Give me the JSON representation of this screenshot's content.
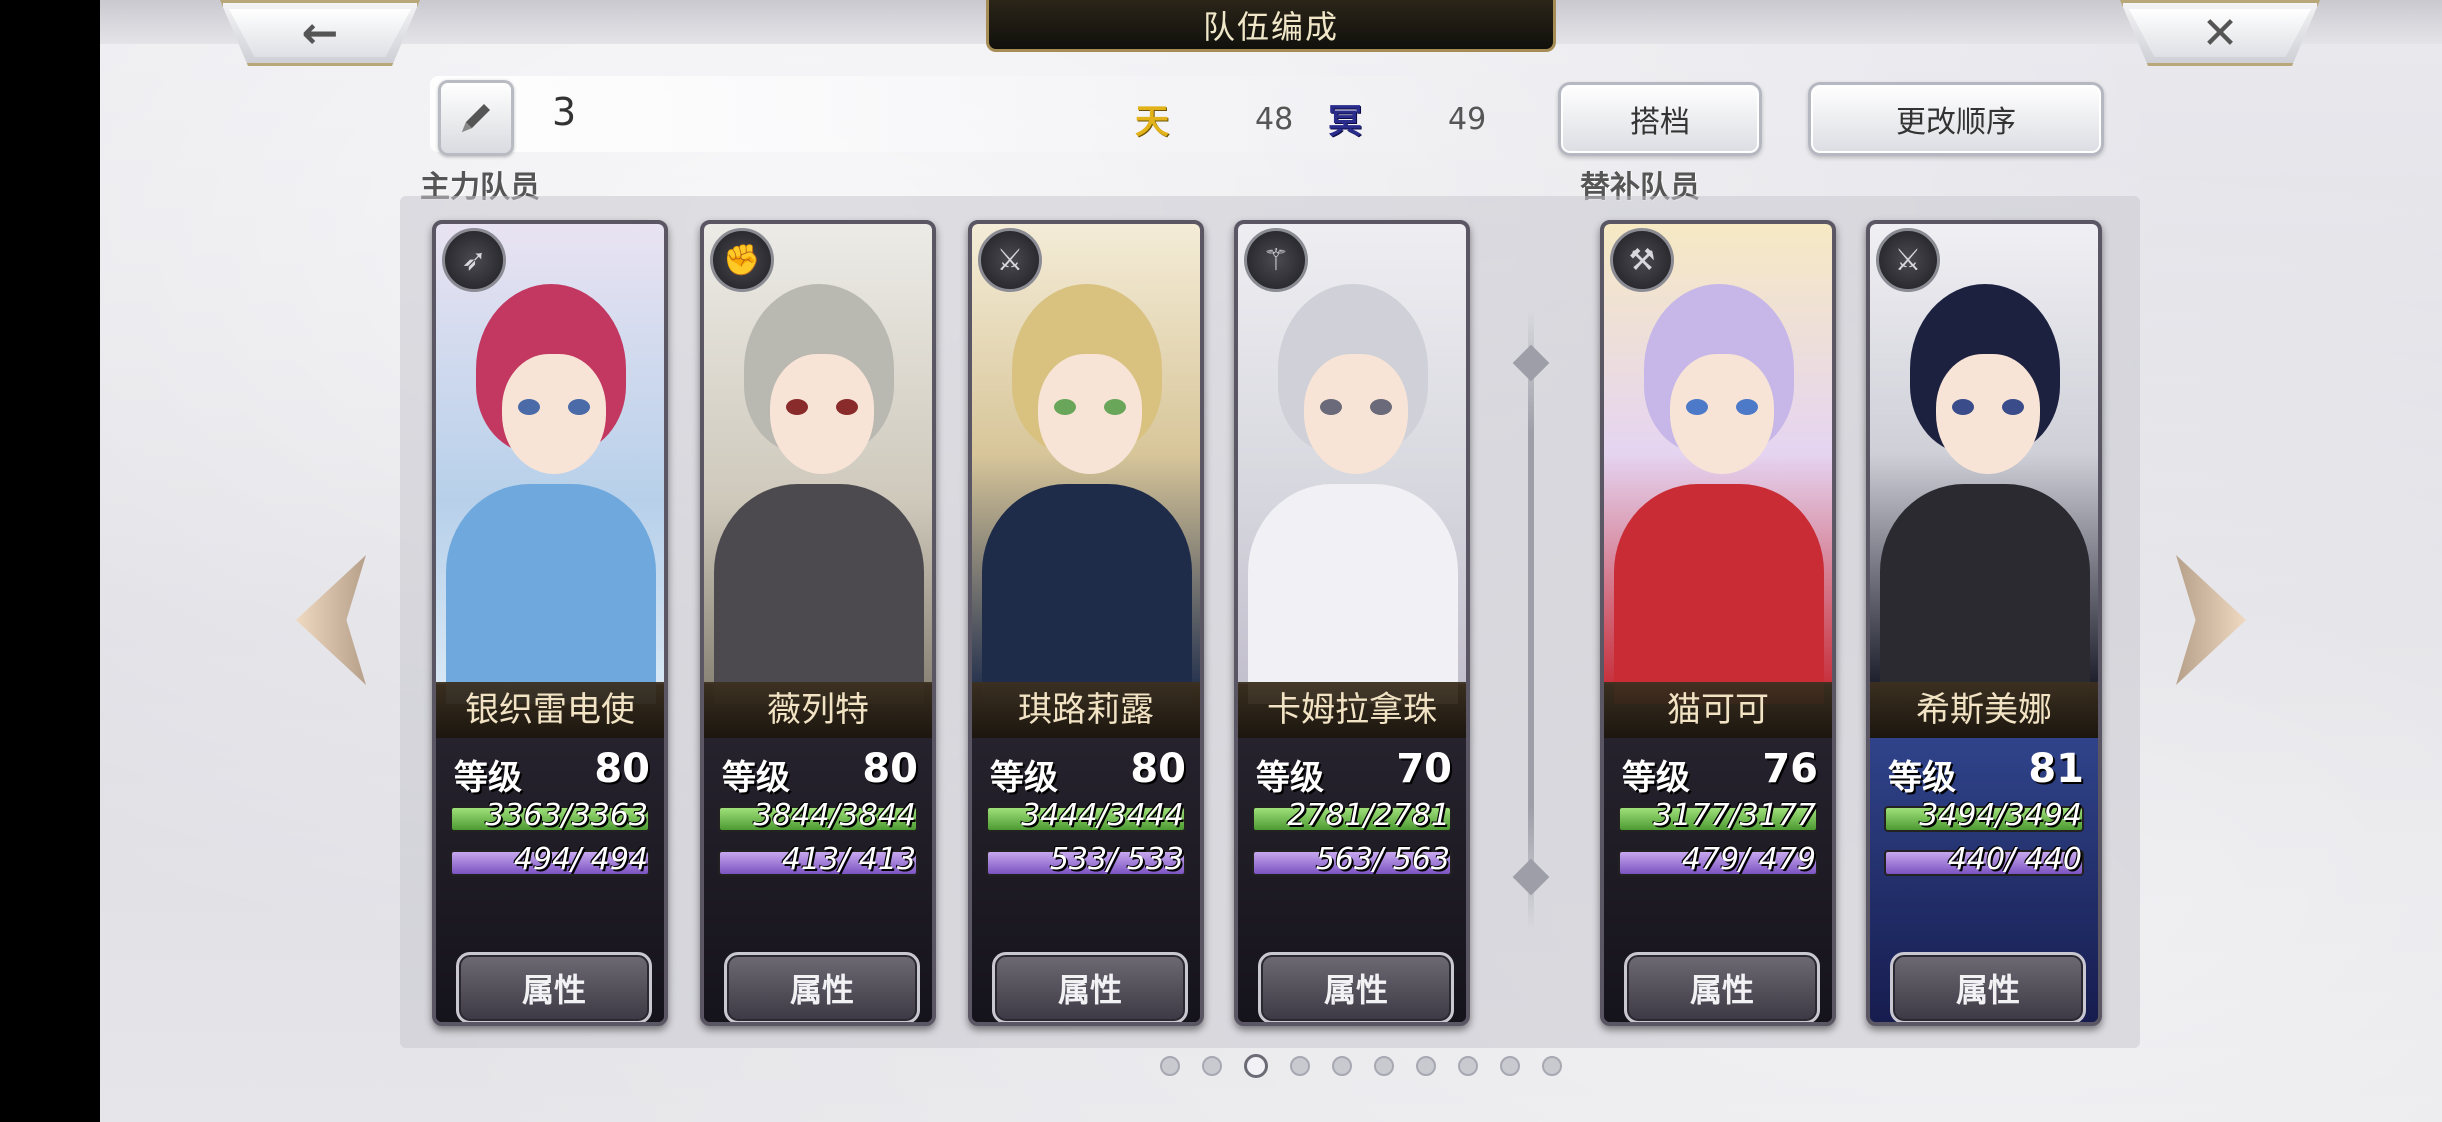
{
  "header": {
    "title": "队伍编成",
    "back_icon": "arrow-left",
    "close_icon": "close-x"
  },
  "party": {
    "number": "3",
    "tian_icon": "天",
    "tian_value": "48",
    "ming_icon": "冥",
    "ming_value": "49",
    "partner_label": "搭档",
    "reorder_label": "更改顺序"
  },
  "sections": {
    "main_label": "主力队员",
    "sub_label": "替补队员"
  },
  "cards": [
    {
      "name": "银织雷电使",
      "level_label": "等级",
      "level": "80",
      "hp": "3363/3363",
      "mp": "494/ 494",
      "attr_label": "属性",
      "class_icon": "bow-icon",
      "eye": "#4a6aa8"
    },
    {
      "name": "薇列特",
      "level_label": "等级",
      "level": "80",
      "hp": "3844/3844",
      "mp": "413/ 413",
      "attr_label": "属性",
      "class_icon": "gauntlet-icon",
      "eye": "#8a2b2b"
    },
    {
      "name": "琪路莉露",
      "level_label": "等级",
      "level": "80",
      "hp": "3444/3444",
      "mp": "533/ 533",
      "attr_label": "属性",
      "class_icon": "sword-icon",
      "eye": "#6aa65a"
    },
    {
      "name": "卡姆拉拿珠",
      "level_label": "等级",
      "level": "70",
      "hp": "2781/2781",
      "mp": "563/ 563",
      "attr_label": "属性",
      "class_icon": "staff-icon",
      "eye": "#6a6a7a"
    },
    {
      "name": "猫可可",
      "level_label": "等级",
      "level": "76",
      "hp": "3177/3177",
      "mp": "479/ 479",
      "attr_label": "属性",
      "class_icon": "axe-icon",
      "eye": "#4d79c9"
    },
    {
      "name": "希斯美娜",
      "level_label": "等级",
      "level": "81",
      "hp": "3494/3494",
      "mp": "440/ 440",
      "attr_label": "属性",
      "class_icon": "sword-icon",
      "eye": "#3a4c8a"
    }
  ],
  "pagination": {
    "total": 10,
    "active": 3
  },
  "colors": {
    "accent_gold": "#a58d55",
    "hp_green": "#4d9a32",
    "mp_purple": "#7b53c1"
  }
}
